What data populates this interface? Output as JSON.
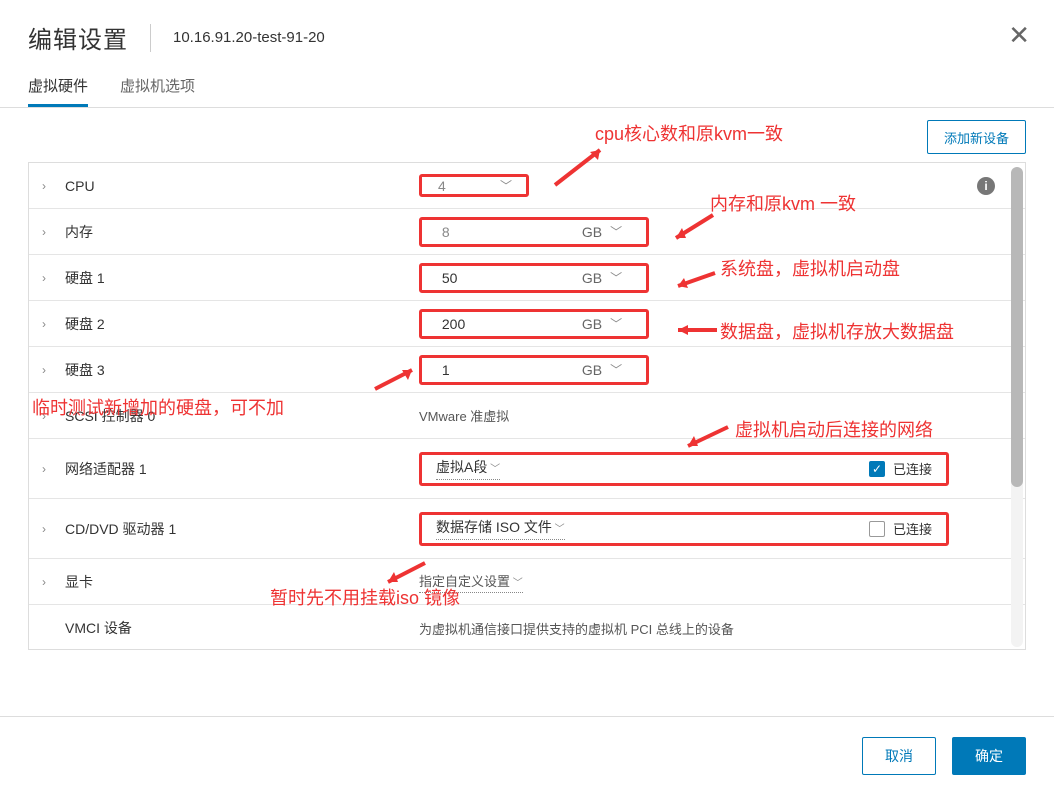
{
  "header": {
    "title": "编辑设置",
    "vm_name": "10.16.91.20-test-91-20"
  },
  "tabs": {
    "hardware": "虚拟硬件",
    "options": "虚拟机选项"
  },
  "toolbar": {
    "add_device": "添加新设备"
  },
  "rows": {
    "cpu": {
      "label": "CPU",
      "value": "4"
    },
    "memory": {
      "label": "内存",
      "value": "8",
      "unit": "GB"
    },
    "disk1": {
      "label": "硬盘 1",
      "value": "50",
      "unit": "GB"
    },
    "disk2": {
      "label": "硬盘 2",
      "value": "200",
      "unit": "GB"
    },
    "disk3": {
      "label": "硬盘 3",
      "value": "1",
      "unit": "GB"
    },
    "scsi": {
      "label": "SCSI 控制器 0",
      "value": "VMware 准虚拟"
    },
    "nic": {
      "label": "网络适配器 1",
      "value": "虚拟A段",
      "connected_label": "已连接",
      "connected": true
    },
    "cd": {
      "label": "CD/DVD 驱动器 1",
      "value": "数据存储 ISO 文件",
      "connected_label": "已连接",
      "connected": false
    },
    "gpu": {
      "label": "显卡",
      "value": "指定自定义设置"
    },
    "vmci": {
      "label": "VMCI 设备",
      "value": "为虚拟机通信接口提供支持的虚拟机 PCI 总线上的设备"
    }
  },
  "footer": {
    "cancel": "取消",
    "ok": "确定"
  },
  "annotations": {
    "cpu": "cpu核心数和原kvm一致",
    "memory": "内存和原kvm 一致",
    "disk1": "系统盘，虚拟机启动盘",
    "disk2": "数据盘，虚拟机存放大数据盘",
    "disk3": "临时测试新增加的硬盘，可不加",
    "nic": "虚拟机启动后连接的网络",
    "cd": "暂时先不用挂载iso 镜像"
  }
}
